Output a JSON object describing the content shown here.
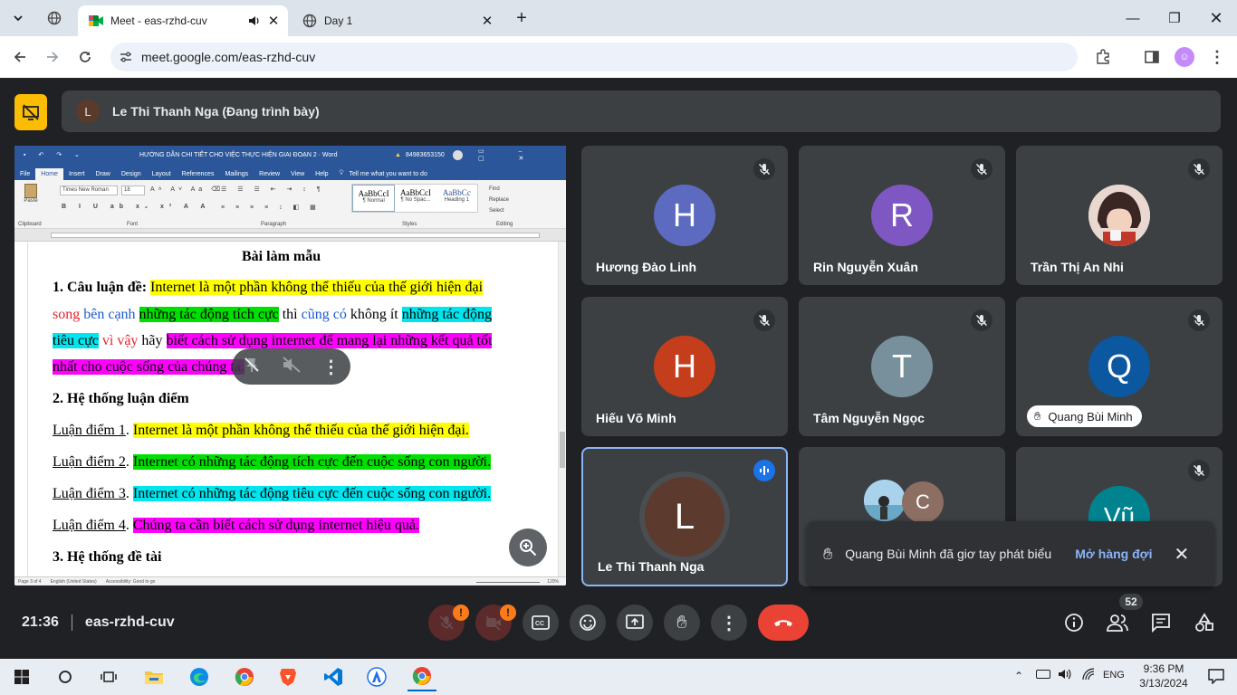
{
  "browser": {
    "tabs": [
      {
        "title": "Meet - eas-rzhd-cuv",
        "active": true
      },
      {
        "title": "Day 1",
        "active": false
      }
    ],
    "url": "meet.google.com/eas-rzhd-cuv"
  },
  "presentation": {
    "presenter_initial": "L",
    "label": "Le Thi Thanh Nga (Đang trình bày)"
  },
  "word": {
    "title": "HƯỚNG DẪN CHI TIẾT CHO VIỆC THỰC HIỆN GIAI ĐOẠN 2 · Word",
    "account": "84983653150",
    "tabs": [
      "File",
      "Home",
      "Insert",
      "Draw",
      "Design",
      "Layout",
      "References",
      "Mailings",
      "Review",
      "View",
      "Help"
    ],
    "tell_me": "Tell me what you want to do",
    "font_name": "Times New Roman",
    "font_size": "18",
    "styles": [
      {
        "preview": "AaBbCcI",
        "name": "¶ Normal"
      },
      {
        "preview": "AaBbCcI",
        "name": "¶ No Spac..."
      },
      {
        "preview": "AaBbCc",
        "name": "Heading 1"
      }
    ],
    "editing": [
      "Find",
      "Replace",
      "Select"
    ],
    "groups": [
      "Clipboard",
      "Font",
      "Paragraph",
      "Styles",
      "Editing"
    ],
    "paste": "Paste",
    "status": {
      "page": "Page 3 of 4",
      "lang": "English (United States)",
      "access": "Accessibility: Good to go",
      "zoom": "120%"
    },
    "heading": "Bài làm mẫu",
    "p1_lead": "1. Câu luận đề:",
    "p1_a": "Internet là một phần không thể thiếu của thế giới hiện đại",
    "p1_b1": "song",
    "p1_b2": "bên cạnh",
    "p1_b3": "những tác động tích cực",
    "p1_b4": "thì",
    "p1_b5": "cũng có",
    "p1_b6": "không ít",
    "p1_b7": "những tác động",
    "p1_c1": "tiêu cực",
    "p1_c2": "vì vậy",
    "p1_c3": "hãy",
    "p1_c4": "biết cách sử dụng internet để mang lại những kết quả tốt",
    "p1_d": "nhất cho cuộc sống của chúng ta.",
    "h2": "2. Hệ thống luận điểm",
    "points": [
      {
        "label": "Luận điểm 1",
        "text": "Internet là một phần không thể thiếu của thế giới hiện đại."
      },
      {
        "label": "Luận điểm 2",
        "text": "Internet có những tác động tích cực đến cuộc sống con người."
      },
      {
        "label": "Luận điểm 3",
        "text": "Internet có những tác động tiêu cực đến cuộc sống con người."
      },
      {
        "label": "Luận điểm 4",
        "text": "Chúng ta cần biết cách sử dụng internet hiệu quả."
      }
    ],
    "h3": "3. Hệ thống đề tài"
  },
  "participants": [
    {
      "initial": "H",
      "name": "Hương Đào Linh",
      "color": "#5c6bc0"
    },
    {
      "initial": "R",
      "name": "Rin Nguyễn Xuân",
      "color": "#7e57c2"
    },
    {
      "initial": "",
      "name": "Trần Thị An Nhi",
      "color": "#9b6a5a"
    },
    {
      "initial": "H",
      "name": "Hiếu Võ Minh",
      "color": "#c43e1c"
    },
    {
      "initial": "T",
      "name": "Tâm Nguyễn Ngọc",
      "color": "#78909c"
    },
    {
      "initial": "Q",
      "name": "Quang Bùi Minh",
      "color": "#0b57a0"
    },
    {
      "initial": "L",
      "name": "Le Thi Thanh Nga",
      "color": "#5d3a2e"
    },
    {
      "initial": "C",
      "name": "",
      "color": "#8d6e63"
    },
    {
      "initial": "Vũ",
      "name": "",
      "color": "#00838f"
    }
  ],
  "toast": {
    "text": "Quang Bùi Minh đã giơ tay phát biểu",
    "action": "Mở hàng đợi"
  },
  "bottom": {
    "time": "21:36",
    "code": "eas-rzhd-cuv",
    "people_count": "52",
    "badge": "!"
  },
  "taskbar": {
    "lang": "ENG",
    "time": "9:36 PM",
    "date": "3/13/2024"
  },
  "colors": {
    "meet_bg": "#202124",
    "tile": "#3c4043",
    "hangup": "#ea4335",
    "accent": "#8ab4f8",
    "presenting": "#fbbc04"
  }
}
